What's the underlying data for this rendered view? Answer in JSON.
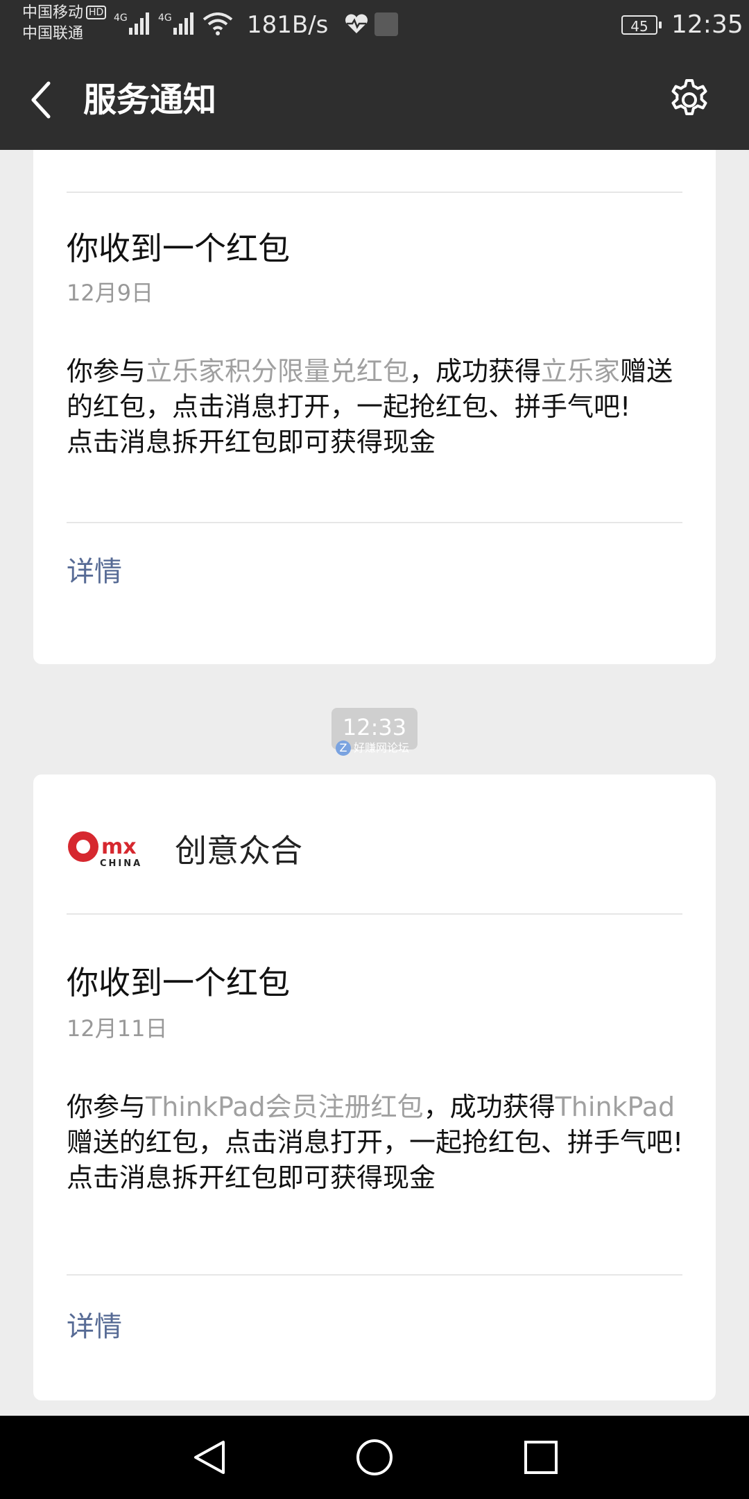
{
  "status_bar": {
    "carrier1": "中国移动",
    "carrier1_badge": "HD",
    "carrier2": "中国联通",
    "network1": "4G",
    "network2": "4G",
    "net_speed": "181B/s",
    "battery": "45",
    "time": "12:35",
    "icons": [
      "signal-icon",
      "wifi-icon",
      "heart-rate-icon",
      "app-icon",
      "battery-icon"
    ]
  },
  "header": {
    "title": "服务通知",
    "back_icon": "chevron-left-icon",
    "settings_icon": "gear-icon"
  },
  "messages": [
    {
      "title": "你收到一个红包",
      "date": "12月9日",
      "body_prefix": "你参与",
      "event": "立乐家积分限量兑红包",
      "body_mid": "，成功获得",
      "sender": "立乐家",
      "body_suffix": "赠送的红包，点击消息打开，一起抢红包、拼手气吧!",
      "body_line2": "点击消息拆开红包即可获得现金",
      "details": "详情"
    },
    {
      "brand_name": "创意众合",
      "brand_logo_text": "mx",
      "brand_logo_sub": "CHINA",
      "title": "你收到一个红包",
      "date": "12月11日",
      "body_prefix": "你参与",
      "event": "ThinkPad会员注册红包",
      "body_mid": "，成功获得",
      "sender": "ThinkPad",
      "body_suffix": "赠送的红包，点击消息打开，一起抢红包、拼手气吧!",
      "body_line2": "点击消息拆开红包即可获得现金",
      "details": "详情"
    }
  ],
  "timestamp_divider": "12:33",
  "watermark": "好赚网论坛",
  "nav_icons": [
    "back-triangle-icon",
    "home-circle-icon",
    "recents-square-icon"
  ],
  "colors": {
    "bar_bg": "#2e2e2e",
    "page_bg": "#ededed",
    "link": "#576b95",
    "highlight_text": "#a0a0a0"
  }
}
